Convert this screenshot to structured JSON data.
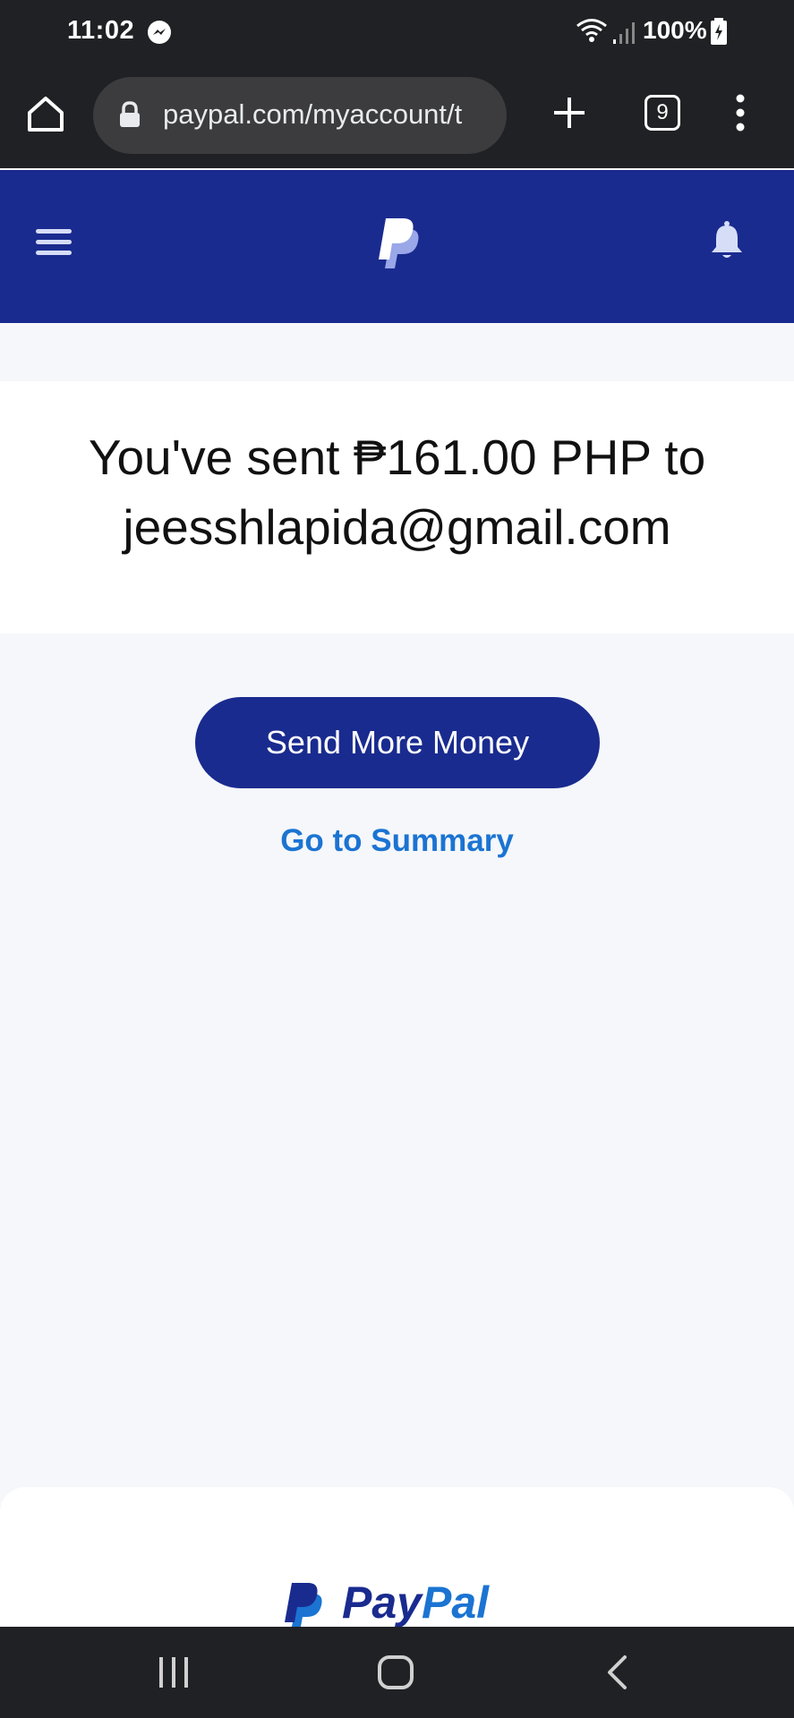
{
  "status_bar": {
    "time": "11:02",
    "battery": "100%"
  },
  "browser": {
    "url": "paypal.com/myaccount/t",
    "tab_count": "9"
  },
  "header": {
    "brand_color": "#1a2b8f"
  },
  "main": {
    "confirmation_message": "You've sent ₱161.00 PHP to jeesshlapida@gmail.com",
    "send_more_label": "Send More Money",
    "summary_link_label": "Go to Summary",
    "link_color": "#1b74d2"
  },
  "footer": {
    "wordmark_pay": "Pay",
    "wordmark_pal": "Pal"
  },
  "icons": [
    "home-icon",
    "lock-icon",
    "plus-icon",
    "tabs-icon",
    "more-icon",
    "menu-icon",
    "paypal-logo",
    "bell-icon",
    "recent-apps-icon",
    "home-nav-icon",
    "back-icon"
  ]
}
